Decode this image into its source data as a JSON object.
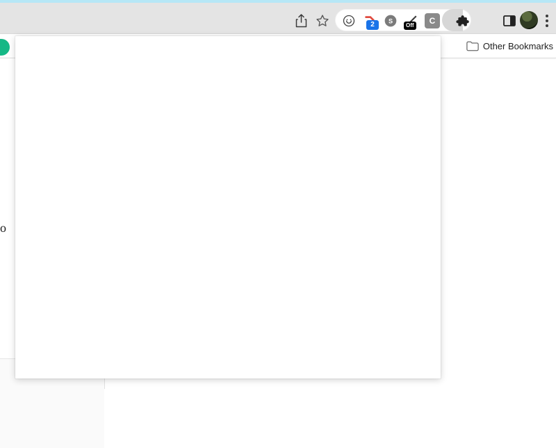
{
  "toolbar": {
    "extension_badge_count": "2",
    "extension_off_label": "Off",
    "c_extension_letter": "C"
  },
  "bookmarks_bar": {
    "other_folder_label": "Other Bookmarks"
  },
  "page": {
    "visible_text_fragment": "o"
  }
}
